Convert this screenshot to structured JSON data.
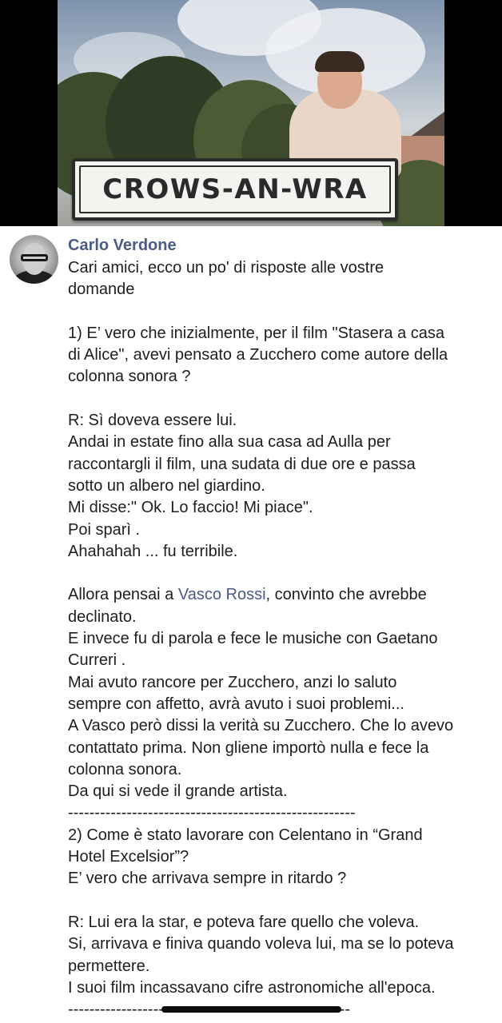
{
  "photo": {
    "sign_text": "CROWS-AN-WRA"
  },
  "post": {
    "author": "Carlo Verdone",
    "lines": [
      "Cari amici, ecco un po' di risposte alle vostre",
      "domande",
      "",
      "1) E’ vero che inizialmente, per il film \"Stasera a casa",
      "di Alice\", avevi pensato a Zucchero come autore della",
      "colonna sonora ?",
      "",
      "R: Sì doveva essere lui.",
      "Andai in estate fino alla sua casa ad Aulla per",
      "raccontargli il film, una sudata di due ore e passa",
      "sotto un albero nel giardino.",
      "Mi disse:\" Ok. Lo faccio! Mi piace\".",
      "Poi sparì .",
      "Ahahahah ... fu terribile.",
      ""
    ],
    "mention_line": {
      "before": "Allora pensai a ",
      "mention": "Vasco Rossi",
      "after": ", convinto che avrebbe"
    },
    "lines_2": [
      "declinato.",
      "E invece fu di parola e fece le musiche con Gaetano",
      "Curreri .",
      "Mai avuto rancore per Zucchero, anzi lo saluto",
      "sempre con affetto, avrà avuto i suoi problemi...",
      "A Vasco però dissi la verità su Zucchero. Che lo avevo",
      "contattato prima. Non gliene importò nulla e fece la",
      "colonna sonora.",
      "Da qui si vede il grande artista."
    ],
    "divider": "------------------------------------------------------",
    "lines_3": [
      "2) Come è stato lavorare con Celentano in “Grand",
      "Hotel Excelsior”?",
      "E’ vero che arrivava sempre in ritardo ?",
      "",
      "R: Lui era la star, e poteva fare quello che voleva.",
      "Si, arrivava e finiva quando voleva lui, ma se lo poteva",
      "permettere.",
      "I suoi film incassavano cifre astronomiche all'epoca."
    ],
    "divider_2": "-----------------------------------------------------"
  }
}
